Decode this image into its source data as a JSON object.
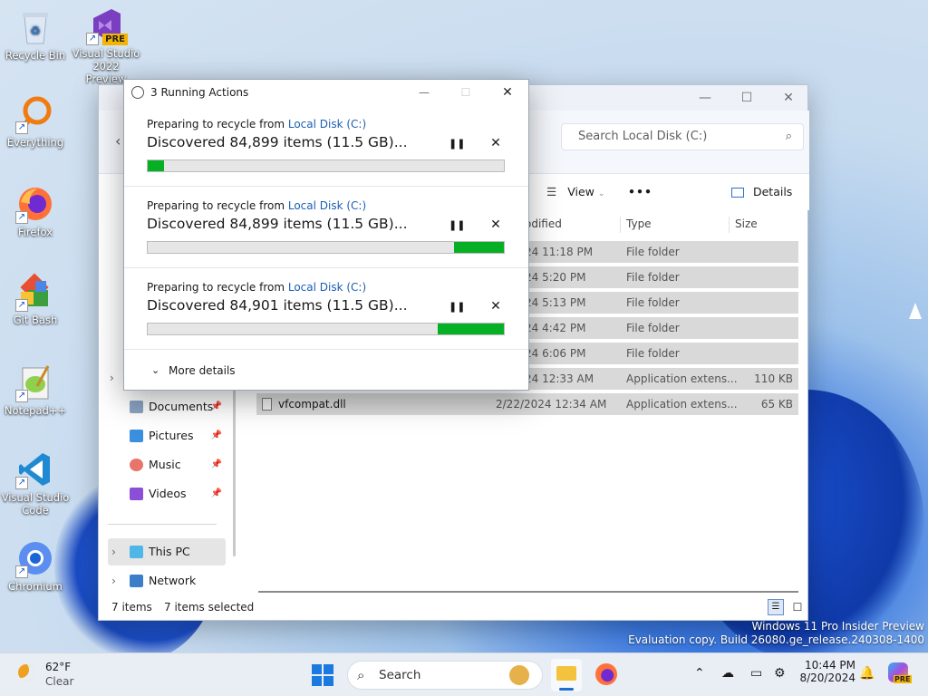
{
  "desktop": {
    "icons": [
      {
        "label": "Recycle Bin",
        "icon": "recycle-bin-icon"
      },
      {
        "label": "Visual Studio 2022 Preview",
        "badge": "PRE",
        "icon": "visual-studio-icon"
      },
      {
        "label": "Everything",
        "icon": "everything-search-icon"
      },
      {
        "label": "Firefox",
        "icon": "firefox-icon"
      },
      {
        "label": "Git Bash",
        "icon": "git-bash-icon"
      },
      {
        "label": "Notepad++",
        "icon": "notepad-plus-plus-icon"
      },
      {
        "label": "Visual Studio Code",
        "icon": "vscode-icon"
      },
      {
        "label": "Chromium",
        "icon": "chromium-icon"
      }
    ]
  },
  "explorer": {
    "search_placeholder": "Search Local Disk (C:)",
    "toolbar": {
      "view_label": "View",
      "more_label": "•••",
      "details_label": "Details"
    },
    "columns": {
      "modified": "odified",
      "type": "Type",
      "size": "Size"
    },
    "rows": [
      {
        "name": "",
        "date": "24 11:18 PM",
        "type": "File folder",
        "size": ""
      },
      {
        "name": "",
        "date": "24 5:20 PM",
        "type": "File folder",
        "size": ""
      },
      {
        "name": "",
        "date": "24 5:13 PM",
        "type": "File folder",
        "size": ""
      },
      {
        "name": "",
        "date": "24 4:42 PM",
        "type": "File folder",
        "size": ""
      },
      {
        "name": "",
        "date": "24 6:06 PM",
        "type": "File folder",
        "size": ""
      },
      {
        "name": "",
        "date": "24 12:33 AM",
        "type": "Application extens...",
        "size": "110 KB"
      },
      {
        "name": "vfcompat.dll",
        "date": "2/22/2024 12:34 AM",
        "type": "Application extens...",
        "size": "65 KB"
      }
    ],
    "sidebar": {
      "documents": "Documents",
      "pictures": "Pictures",
      "music": "Music",
      "videos": "Videos",
      "this_pc": "This PC",
      "network": "Network"
    },
    "status": {
      "items": "7 items",
      "selected": "7 items selected"
    }
  },
  "dialog": {
    "title": "3 Running Actions",
    "operations": [
      {
        "prefix": "Preparing to recycle from ",
        "location": "Local Disk (C:)",
        "status": "Discovered 84,899 items (11.5 GB)...",
        "progress": 0.045
      },
      {
        "prefix": "Preparing to recycle from ",
        "location": "Local Disk (C:)",
        "status": "Discovered 84,899 items (11.5 GB)...",
        "progress": 0.14
      },
      {
        "prefix": "Preparing to recycle from ",
        "location": "Local Disk (C:)",
        "status": "Discovered 84,901 items (11.5 GB)...",
        "progress": 0.185
      }
    ],
    "more_details": "More details"
  },
  "watermark": {
    "line1": "Windows 11 Pro Insider Preview",
    "line2": "Evaluation copy. Build 26080.ge_release.240308-1400"
  },
  "taskbar": {
    "weather": {
      "temp": "62°F",
      "condition": "Clear"
    },
    "search_label": "Search",
    "clock": {
      "time": "10:44 PM",
      "date": "8/20/2024"
    },
    "copilot_badge": "PRE"
  }
}
